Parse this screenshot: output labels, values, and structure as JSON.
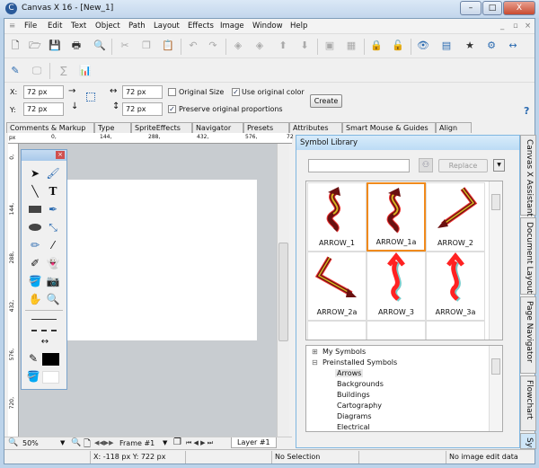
{
  "window": {
    "title": "Canvas X 16 - [New_1]",
    "minimize": "–",
    "maximize": "□",
    "close": "X"
  },
  "menu": [
    "File",
    "Edit",
    "Text",
    "Object",
    "Path",
    "Layout",
    "Effects",
    "Image",
    "Window",
    "Help"
  ],
  "props": {
    "x_label": "X:",
    "x_value": "72 px",
    "y_label": "Y:",
    "y_value": "72 px",
    "w_value": "72 px",
    "h_value": "72 px",
    "original_size": "Original Size",
    "original_size_checked": false,
    "use_original_color": "Use original color",
    "use_original_color_checked": true,
    "preserve_proportions": "Preserve original proportions",
    "preserve_proportions_checked": true,
    "create": "Create",
    "help": "?"
  },
  "tabs": [
    "Comments & Markup",
    "Type",
    "SpriteEffects",
    "Navigator",
    "Presets",
    "Attributes",
    "Smart Mouse & Guides",
    "Align"
  ],
  "ruler": {
    "unit": "px",
    "h_ticks": [
      "0,",
      "144,",
      "288,",
      "432,",
      "576,",
      "72"
    ],
    "v_ticks": [
      "0,",
      "144,",
      "288,",
      "432,",
      "576,",
      "720,"
    ]
  },
  "bottombar": {
    "zoom": "50%",
    "frame": "Frame #1",
    "layer": "Layer #1"
  },
  "status": {
    "coords": "X: -118 px Y: 722 px",
    "selection": "No Selection",
    "image": "No image edit data"
  },
  "symbol_library": {
    "title": "Symbol Library",
    "search_value": "",
    "replace": "Replace",
    "symbols": [
      {
        "name": "ARROW_1",
        "selected": false
      },
      {
        "name": "ARROW_1a",
        "selected": true
      },
      {
        "name": "ARROW_2",
        "selected": false
      },
      {
        "name": "ARROW_2a",
        "selected": false
      },
      {
        "name": "ARROW_3",
        "selected": false
      },
      {
        "name": "ARROW_3a",
        "selected": false
      }
    ],
    "tree": {
      "my_symbols": "My Symbols",
      "preinstalled": "Preinstalled Symbols",
      "children": [
        "Arrows",
        "Backgrounds",
        "Buildings",
        "Cartography",
        "Diagrams",
        "Electrical"
      ],
      "selected": "Arrows"
    }
  },
  "side_tabs": [
    "Canvas X Assistant",
    "Document Layout",
    "Page Navigator",
    "Flowchart",
    "Sym"
  ],
  "colors": {
    "accent": "#f08a1c",
    "panel_border": "#7fb6e0",
    "canvas_bg": "#c8ccd0"
  }
}
